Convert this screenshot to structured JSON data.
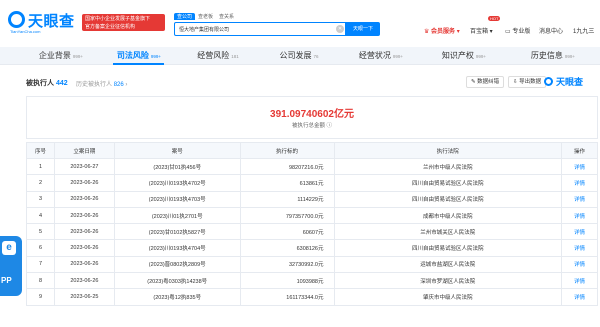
{
  "brand": {
    "name": "天眼查",
    "url": "TianYanCha.com",
    "promo_line1": "国家中小企业发展子基金旗下",
    "promo_line2": "官方备案企业征信机构"
  },
  "search": {
    "tabs": [
      "查公司",
      "查老板",
      "查关系"
    ],
    "value": "恒大地产集团有限公司",
    "clear_icon": "✕",
    "button": "天眼一下"
  },
  "topnav": {
    "vip": "会员服务",
    "products": "百宝箱",
    "products_badge": "HOT",
    "pro": "专业版",
    "messages": "消息中心",
    "user": "1九九三"
  },
  "categories": [
    {
      "label": "企业背景",
      "count": "999+"
    },
    {
      "label": "司法风险",
      "count": "999+"
    },
    {
      "label": "经营风险",
      "count": "181"
    },
    {
      "label": "公司发展",
      "count": "76"
    },
    {
      "label": "经营状况",
      "count": "999+"
    },
    {
      "label": "知识产权",
      "count": "999+"
    },
    {
      "label": "历史信息",
      "count": "999+"
    }
  ],
  "section": {
    "title": "被执行人",
    "count": "442",
    "history_label": "历史被执行人",
    "history_count": "826",
    "history_arrow": "›",
    "btn_feedback": "数据纠错",
    "btn_export": "导出数据",
    "watermark": "天眼查"
  },
  "summary": {
    "amount": "391.09740602亿元",
    "label": "被执行总金额"
  },
  "table": {
    "headers": [
      "序号",
      "立案日期",
      "案号",
      "执行标的",
      "执行法院",
      "操作"
    ],
    "rows": [
      [
        "1",
        "2023-06-27",
        "(2023)甘01执456号",
        "98207216.0元",
        "兰州市中级人民法院",
        "详情"
      ],
      [
        "2",
        "2023-06-26",
        "(2023)川0193执4702号",
        "613861元",
        "四川自由贸易试验区人民法院",
        "详情"
      ],
      [
        "3",
        "2023-06-26",
        "(2023)川0193执4703号",
        "1114229元",
        "四川自由贸易试验区人民法院",
        "详情"
      ],
      [
        "4",
        "2023-06-26",
        "(2023)川01执2701号",
        "797357700.0元",
        "成都市中级人民法院",
        "详情"
      ],
      [
        "5",
        "2023-06-26",
        "(2023)甘0102执5827号",
        "60607元",
        "兰州市城关区人民法院",
        "详情"
      ],
      [
        "6",
        "2023-06-26",
        "(2023)川0193执4704号",
        "6308126元",
        "四川自由贸易试验区人民法院",
        "详情"
      ],
      [
        "7",
        "2023-06-26",
        "(2023)晋0802执2809号",
        "32730992.0元",
        "运城市盐湖区人民法院",
        "详情"
      ],
      [
        "8",
        "2023-06-26",
        "(2023)粤0303执14238号",
        "1093988元",
        "深圳市罗湖区人民法院",
        "详情"
      ],
      [
        "9",
        "2023-06-25",
        "(2023)粤12执835号",
        "161173344.0元",
        "肇庆市中级人民法院",
        "详情"
      ]
    ]
  },
  "side_widget": {
    "letter": "e",
    "text": "PP"
  }
}
